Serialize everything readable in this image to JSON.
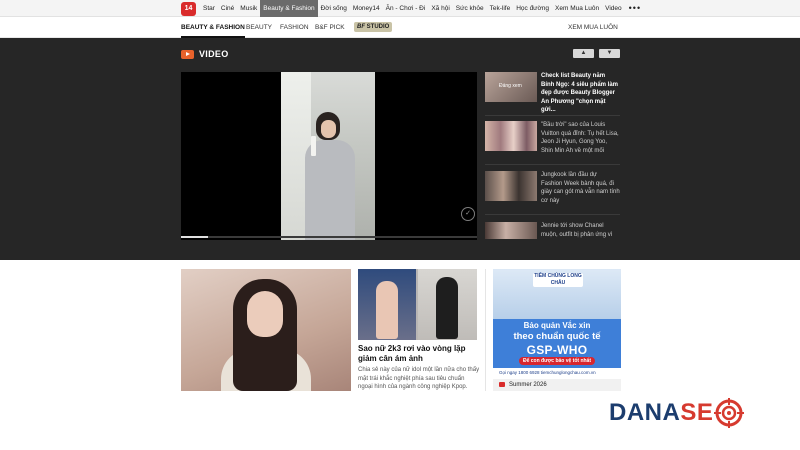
{
  "topnav": {
    "logo": "14",
    "items": [
      "Star",
      "Ciné",
      "Musik",
      "Beauty & Fashion",
      "Đời sống",
      "Money14",
      "Ăn - Chơi - Đi",
      "Xã hội",
      "Sức khỏe",
      "Tek-life",
      "Học đường",
      "Xem Mua Luôn",
      "Video"
    ],
    "active_index": 3,
    "more": "•••"
  },
  "subnav": {
    "items": [
      "BEAUTY & FASHION",
      "BEAUTY",
      "FASHION",
      "B&F PICK"
    ],
    "studio": "STUDIO",
    "right": "XEM MUA LUÔN"
  },
  "video_section": {
    "title": "VIDEO",
    "prev_icon": "▲",
    "next_icon": "▼",
    "progress": 0.09,
    "side_items": [
      {
        "text": "Check list Beauty năm Bính Ngọ: 4 siêu phẩm làm đẹp được Beauty Blogger An Phương \"chọn mặt gửi...",
        "bold": true,
        "thumb_label": "Đáng xem"
      },
      {
        "text": "\"Bầu trời\" sao của Louis Vuitton quá đỉnh: Tụ hết Lisa, Jeon Ji Hyun, Gong Yoo, Shin Min Ah về một mối",
        "bold": false,
        "thumb_label": ""
      },
      {
        "text": "Jungkook lần đầu dự Fashion Week bành quá, đi giày can gót mà vẫn nam tính cơ này",
        "bold": false,
        "thumb_label": ""
      },
      {
        "text": "Jennie tới show Chanel muộn, outfit bị phản ứng vì",
        "bold": false,
        "thumb_label": ""
      }
    ]
  },
  "article2": {
    "title": "Sao nữ 2k3 rơi vào vòng lặp giảm cân ám ảnh",
    "desc": "Chia sẻ này của nữ idol một lần nữa cho thấy mặt trái khắc nghiệt phía sau tiêu chuẩn ngoại hình của ngành công nghiệp Kpop."
  },
  "ad": {
    "brand": "TIÊM CHỦNG LONG CHÂU",
    "line1": "Bảo quản Vắc xin",
    "line2": "theo chuẩn quốc tế",
    "line3": "GSP-WHO",
    "cta": "Để con được bảo vệ tốt nhất",
    "footer": "Gọi ngay 1800 6928   tiemchunglongchau.com.vn"
  },
  "summer": "Summer 2026",
  "watermark": {
    "dana": "DANA",
    "se": "SE"
  },
  "colors": {
    "video_bg": "#262626",
    "accent_orange": "#e8622b",
    "brand_red": "#d92b2b",
    "ad_blue": "#3e7fd8",
    "danaseo_navy": "#1c3d6e",
    "danaseo_red": "#d63a2f"
  }
}
